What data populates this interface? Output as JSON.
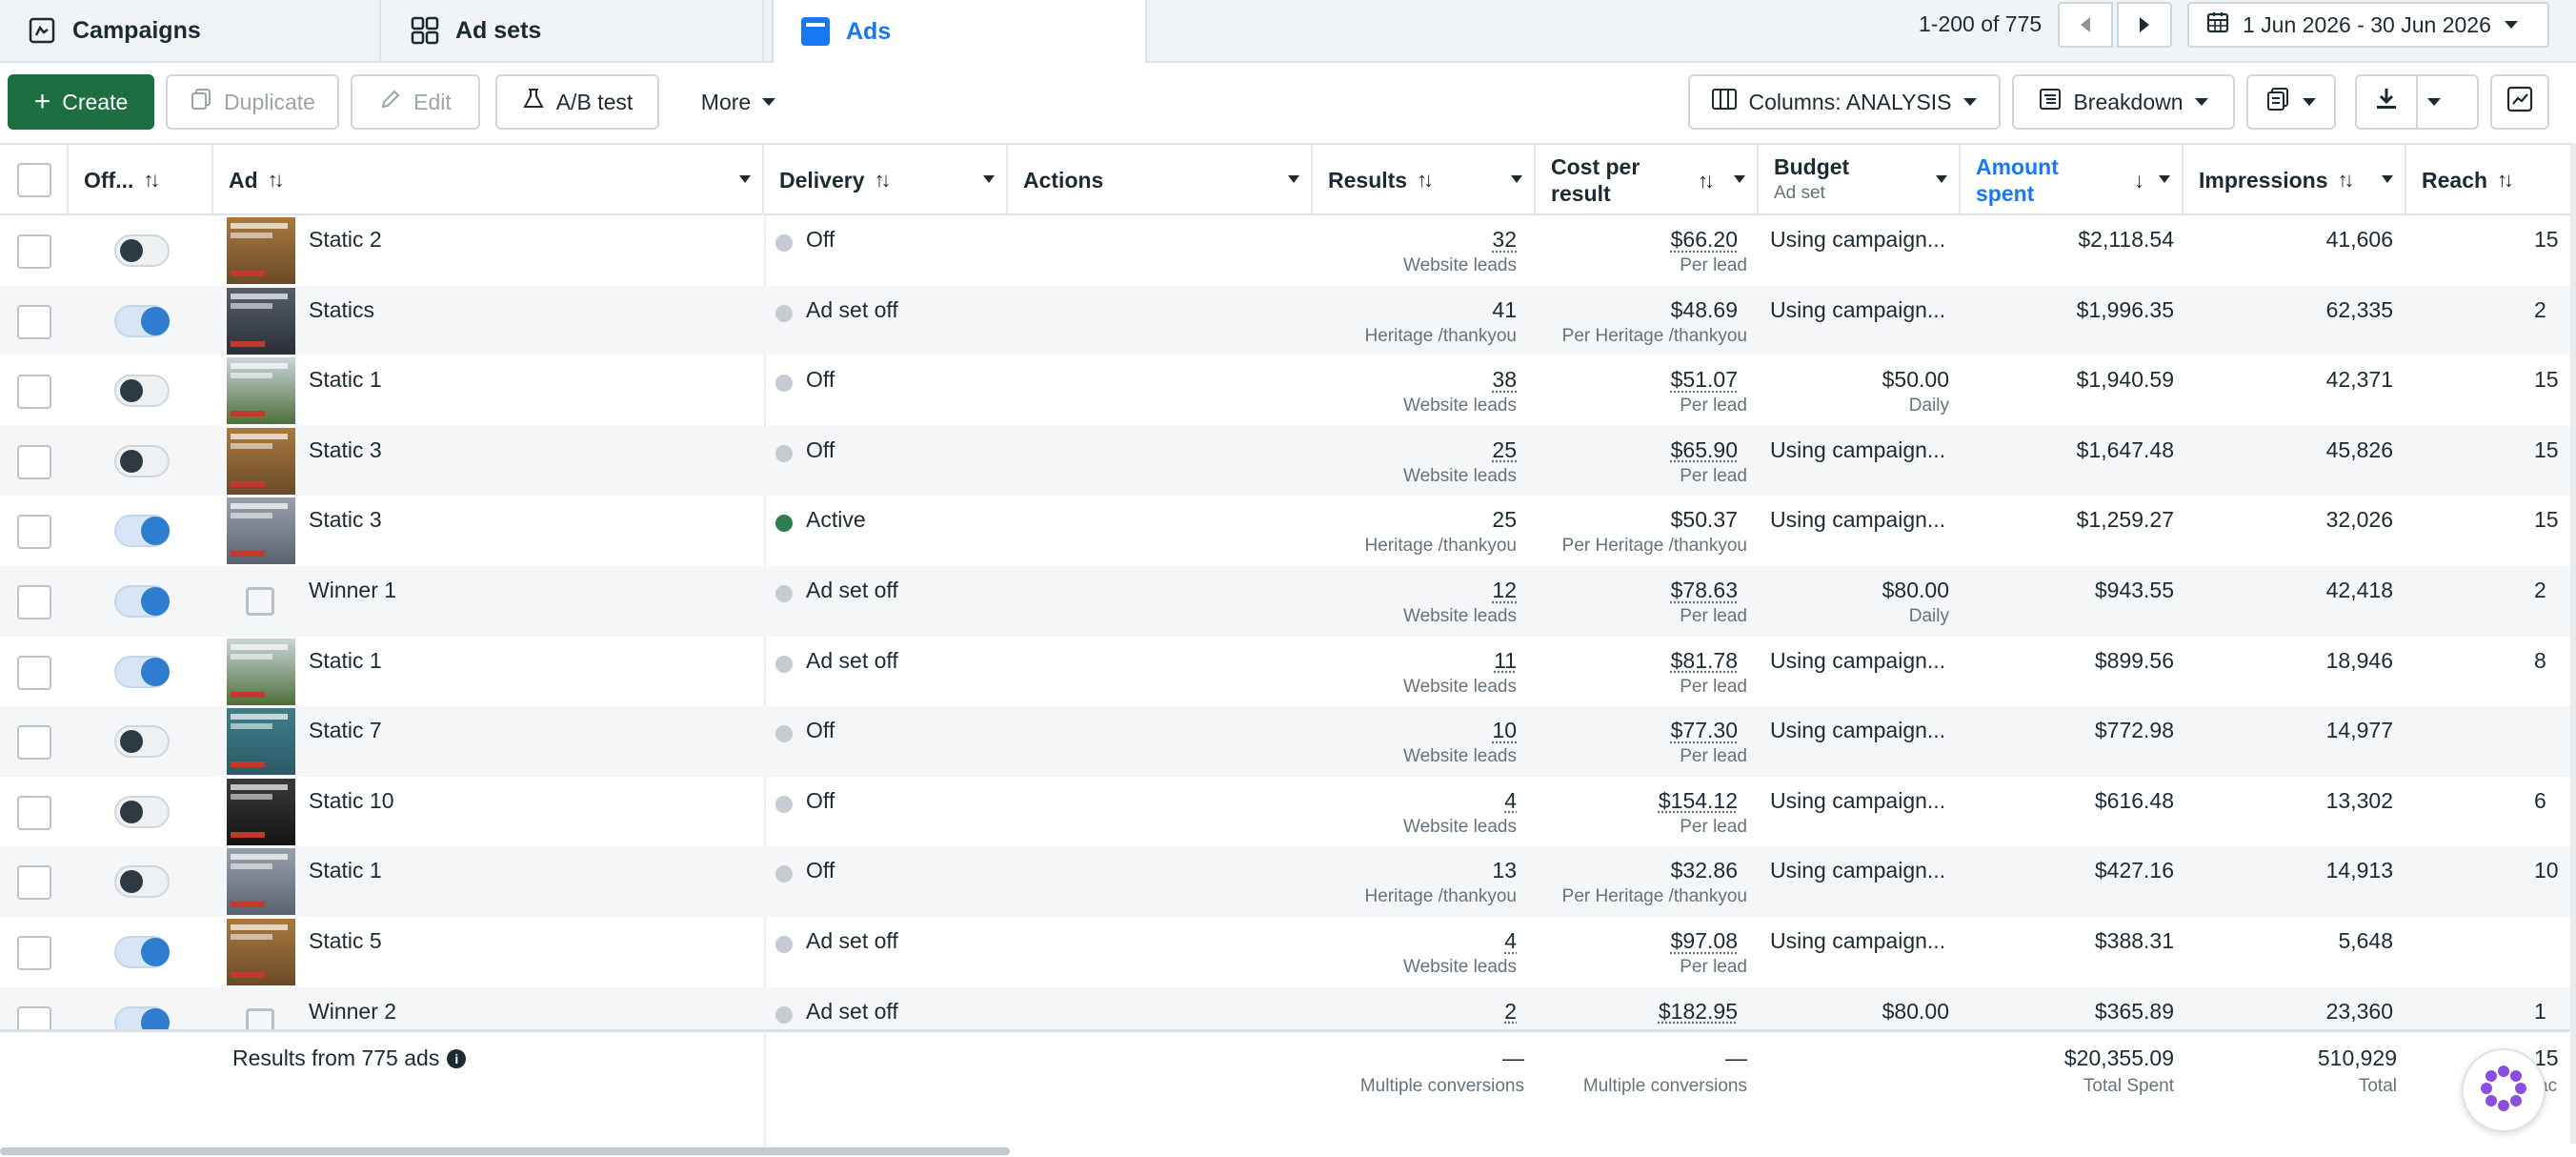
{
  "tabs": [
    {
      "label": "Campaigns",
      "icon": "campaigns-icon"
    },
    {
      "label": "Ad sets",
      "icon": "grid-icon"
    },
    {
      "label": "Ads",
      "icon": "ads-icon",
      "active": true
    }
  ],
  "pager": {
    "text": "1-200 of 775"
  },
  "date_range": "1 Jun 2026 - 30 Jun 2026",
  "toolbar": {
    "create": "Create",
    "duplicate": "Duplicate",
    "edit": "Edit",
    "ab_test": "A/B test",
    "more": "More",
    "columns": "Columns: ANALYSIS",
    "breakdown": "Breakdown"
  },
  "columns": {
    "off": "Off...",
    "ad": "Ad",
    "delivery": "Delivery",
    "actions": "Actions",
    "results": "Results",
    "cost_line1": "Cost per",
    "cost_line2": "result",
    "budget": "Budget",
    "budget_sub": "Ad set",
    "amount_line1": "Amount",
    "amount_line2": "spent",
    "impressions": "Impressions",
    "reach": "Reach"
  },
  "rows": [
    {
      "on": false,
      "name": "Static 2",
      "delivery": "Off",
      "results": "32",
      "results_sub": "Website leads",
      "cost": "$66.20",
      "cost_sub": "Per lead",
      "budget": "Using campaign...",
      "budget_sub": "",
      "amount": "$2,118.54",
      "impressions": "41,606",
      "reach": "15",
      "thumb": "house"
    },
    {
      "on": true,
      "name": "Statics",
      "delivery": "Ad set off",
      "results": "41",
      "results_sub": "Heritage /thankyou",
      "cost": "$48.69",
      "cost_sub": "Per Heritage /thankyou",
      "budget": "Using campaign...",
      "budget_sub": "",
      "amount": "$1,996.35",
      "impressions": "62,335",
      "reach": "2",
      "thumb": "dark"
    },
    {
      "on": false,
      "name": "Static 1",
      "delivery": "Off",
      "results": "38",
      "results_sub": "Website leads",
      "cost": "$51.07",
      "cost_sub": "Per lead",
      "budget": "$50.00",
      "budget_sub": "Daily",
      "amount": "$1,940.59",
      "impressions": "42,371",
      "reach": "15",
      "thumb": "green"
    },
    {
      "on": false,
      "name": "Static 3",
      "delivery": "Off",
      "results": "25",
      "results_sub": "Website leads",
      "cost": "$65.90",
      "cost_sub": "Per lead",
      "budget": "Using campaign...",
      "budget_sub": "",
      "amount": "$1,647.48",
      "impressions": "45,826",
      "reach": "15",
      "thumb": "house"
    },
    {
      "on": true,
      "name": "Static 3",
      "delivery": "Active",
      "results": "25",
      "results_sub": "Heritage /thankyou",
      "cost": "$50.37",
      "cost_sub": "Per Heritage /thankyou",
      "budget": "Using campaign...",
      "budget_sub": "",
      "amount": "$1,259.27",
      "impressions": "32,026",
      "reach": "15",
      "thumb": "grey"
    },
    {
      "on": true,
      "name": "Winner 1",
      "delivery": "Ad set off",
      "results": "12",
      "results_sub": "Website leads",
      "cost": "$78.63",
      "cost_sub": "Per lead",
      "budget": "$80.00",
      "budget_sub": "Daily",
      "amount": "$943.55",
      "impressions": "42,418",
      "reach": "2",
      "thumb": "none"
    },
    {
      "on": true,
      "name": "Static 1",
      "delivery": "Ad set off",
      "results": "11",
      "results_sub": "Website leads",
      "cost": "$81.78",
      "cost_sub": "Per lead",
      "budget": "Using campaign...",
      "budget_sub": "",
      "amount": "$899.56",
      "impressions": "18,946",
      "reach": "8",
      "thumb": "green"
    },
    {
      "on": false,
      "name": "Static 7",
      "delivery": "Off",
      "results": "10",
      "results_sub": "Website leads",
      "cost": "$77.30",
      "cost_sub": "Per lead",
      "budget": "Using campaign...",
      "budget_sub": "",
      "amount": "$772.98",
      "impressions": "14,977",
      "reach": "",
      "thumb": "teal"
    },
    {
      "on": false,
      "name": "Static 10",
      "delivery": "Off",
      "results": "4",
      "results_sub": "Website leads",
      "cost": "$154.12",
      "cost_sub": "Per lead",
      "budget": "Using campaign...",
      "budget_sub": "",
      "amount": "$616.48",
      "impressions": "13,302",
      "reach": "6",
      "thumb": "black"
    },
    {
      "on": false,
      "name": "Static 1",
      "delivery": "Off",
      "results": "13",
      "results_sub": "Heritage /thankyou",
      "cost": "$32.86",
      "cost_sub": "Per Heritage /thankyou",
      "budget": "Using campaign...",
      "budget_sub": "",
      "amount": "$427.16",
      "impressions": "14,913",
      "reach": "10",
      "thumb": "grey"
    },
    {
      "on": true,
      "name": "Static 5",
      "delivery": "Ad set off",
      "results": "4",
      "results_sub": "Website leads",
      "cost": "$97.08",
      "cost_sub": "Per lead",
      "budget": "Using campaign...",
      "budget_sub": "",
      "amount": "$388.31",
      "impressions": "5,648",
      "reach": "",
      "thumb": "house"
    },
    {
      "on": true,
      "name": "Winner 2",
      "delivery": "Ad set off",
      "results": "2",
      "results_sub": "",
      "cost": "$182.95",
      "cost_sub": "",
      "budget": "$80.00",
      "budget_sub": "",
      "amount": "$365.89",
      "impressions": "23,360",
      "reach": "1",
      "thumb": "none"
    }
  ],
  "footer": {
    "summary": "Results from 775 ads",
    "results": "—",
    "results_sub": "Multiple conversions",
    "cost": "—",
    "cost_sub": "Multiple conversions",
    "amount": "$20,355.09",
    "amount_sub": "Total Spent",
    "impressions": "510,929",
    "impressions_sub": "Total",
    "reach": "15",
    "reach_sub": "ac"
  },
  "colors": {
    "accent": "#1877f2",
    "create": "#1d6f42",
    "active_dot": "#2e7d4f"
  }
}
